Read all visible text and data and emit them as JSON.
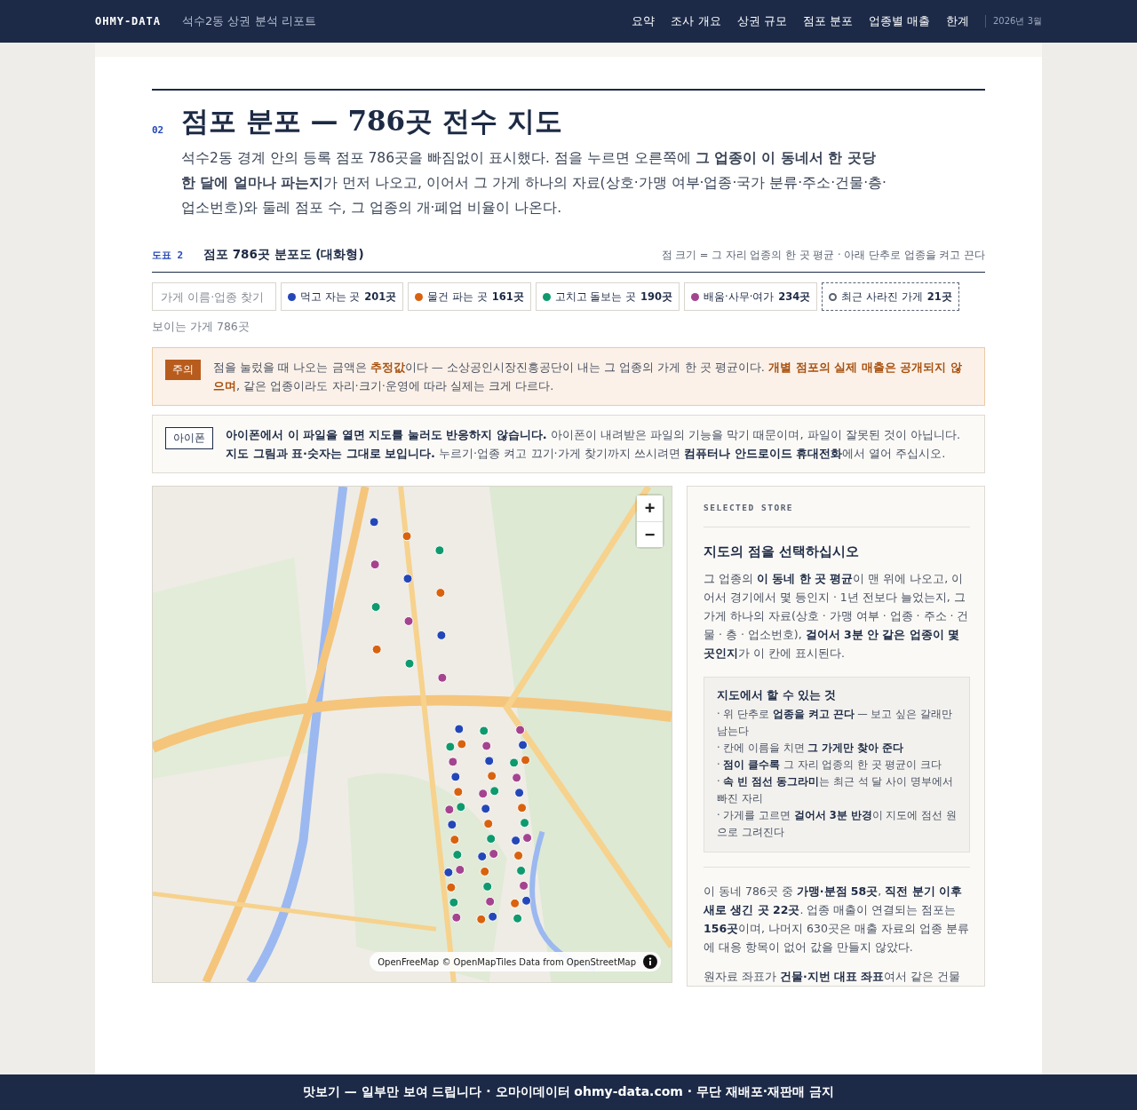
{
  "header": {
    "brand": "OHMY-DATA",
    "subtitle": "석수2동 상권 분석 리포트",
    "nav": [
      "요약",
      "조사 개요",
      "상권 규모",
      "점포 분포",
      "업종별 매출",
      "한계"
    ],
    "date": "2026년 3월"
  },
  "section": {
    "number": "02",
    "title": "점포 분포 — 786곳 전수 지도",
    "intro": "석수2동 경계 안의 등록 점포 786곳을 빠짐없이 표시했다. 점을 누르면 오른쪽에 **그 업종이 이 동네서 한 곳당 한 달에 얼마나 파는지**가 먼저 나오고, 이어서 그 가게 하나의 자료(상호·가맹 여부·업종·국가 분류·주소·건물·층·업소번호)와 둘레 점포 수, 그 업종의 개·폐업 비율이 나온다."
  },
  "figure": {
    "label": "도표 2",
    "title": "점포 786곳 분포도 (대화형)",
    "note": "점 크기 = 그 자리 업종의 한 곳 평균 · 아래 단추로 업종을 켜고 끈다"
  },
  "search": {
    "placeholder": "가게 이름·업종 찾기"
  },
  "filters": [
    {
      "kind": "category",
      "label": "먹고 자는 곳",
      "count": "201곳",
      "color": "#2447b8"
    },
    {
      "kind": "category",
      "label": "물건 파는 곳",
      "count": "161곳",
      "color": "#d9620f"
    },
    {
      "kind": "category",
      "label": "고치고 돌보는 곳",
      "count": "190곳",
      "color": "#0f9a6e"
    },
    {
      "kind": "category",
      "label": "배움·사무·여가",
      "count": "234곳",
      "color": "#a4448f"
    },
    {
      "kind": "closed",
      "label": "최근 사라진 가게",
      "count": "21곳",
      "color": "#5a6272"
    }
  ],
  "visible_count": "보이는 가게 786곳",
  "notices": [
    {
      "kind": "caution",
      "badge": "주의",
      "text": "점을 눌렀을 때 나오는 금액은 **추정값**이다 — 소상공인시장진흥공단이 내는 그 업종의 가게 한 곳 평균이다. **개별 점포의 실제 매출은 공개되지 않으며**, 같은 업종이라도 자리·크기·운영에 따라 실제는 크게 다르다."
    },
    {
      "kind": "device",
      "badge": "아이폰",
      "text": "**아이폰에서 이 파일을 열면 지도를 눌러도 반응하지 않습니다.** 아이폰이 내려받은 파일의 기능을 막기 때문이며, 파일이 잘못된 것이 아닙니다. **지도 그림과 표·숫자는 그대로 보입니다.** 누르기·업종 켜고 끄기·가게 찾기까지 쓰시려면 **컴퓨터나 안드로이드 휴대전화**에서 열어 주십시오."
    }
  ],
  "map": {
    "zoom_in": "+",
    "zoom_out": "−",
    "attribution": "OpenFreeMap © OpenMapTiles Data from OpenStreetMap"
  },
  "panel": {
    "eyebrow": "SELECTED STORE",
    "heading": "지도의 점을 선택하십시오",
    "body": "그 업종의 **이 동네 한 곳 평균**이 맨 위에 나오고, 이어서 경기에서 몇 등인지 · 1년 전보다 늘었는지, 그 가게 하나의 자료(상호 · 가맹 여부 · 업종 · 주소 · 건물 · 층 · 업소번호), **걸어서 3분 안 같은 업종이 몇 곳인지**가 이 칸에 표시된다.",
    "tips": {
      "title": "지도에서 할 수 있는 것",
      "items": [
        "· 위 단추로 **업종을 켜고 끈다** — 보고 싶은 갈래만 남는다",
        "· 칸에 이름을 치면 **그 가게만 찾아 준다**",
        "· **점이 클수록** 그 자리 업종의 한 곳 평균이 크다",
        "· **속 빈 점선 동그라미**는 최근 석 달 사이 명부에서 빠진 자리",
        "· 가게를 고르면 **걸어서 3분 반경**이 지도에 점선 원으로 그려진다"
      ]
    },
    "summary": "이 동네 786곳 중 **가맹·분점 58곳**, **직전 분기 이후 새로 생긴 곳 22곳**. 업종 매출이 연결되는 점포는 **156곳**이며, 나머지 630곳은 매출 자료의 업종 분류에 대응 항목이 없어 값을 만들지 않았다.",
    "note": "원자료 좌표가 **건물·지번 대표 좌표**여서 같은 건물"
  },
  "footer": "맛보기 — 일부만 보여 드립니다 · 오마이데이터 ohmy-data.com · 무단 재배포·재판매 금지"
}
